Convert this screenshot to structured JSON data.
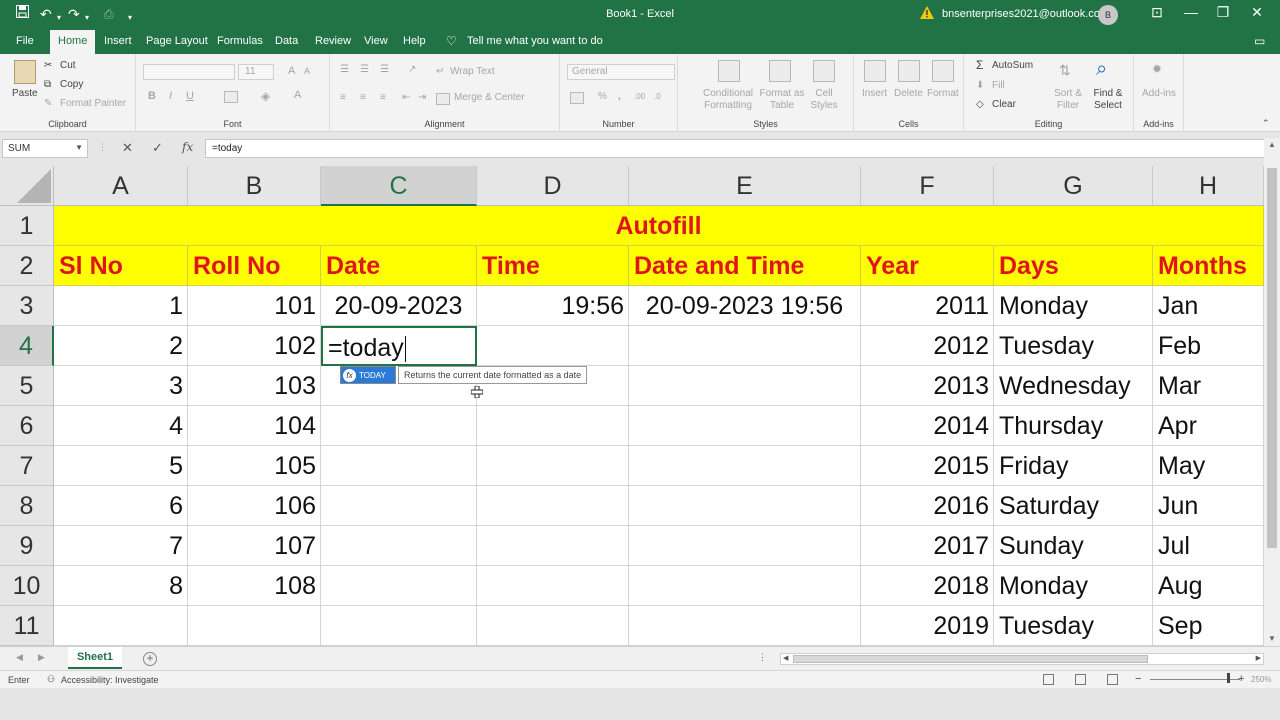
{
  "window": {
    "title": "Book1 - Excel",
    "account_email": "bnsenterprises2021@outlook.com",
    "avatar_initial": "B"
  },
  "menu": {
    "tabs": [
      "File",
      "Home",
      "Insert",
      "Page Layout",
      "Formulas",
      "Data",
      "Review",
      "View",
      "Help"
    ],
    "active_tab": "Home",
    "tell_me": "Tell me what you want to do"
  },
  "ribbon": {
    "clipboard": {
      "label": "Clipboard",
      "paste": "Paste",
      "cut": "Cut",
      "copy": "Copy",
      "format_painter": "Format Painter"
    },
    "font": {
      "label": "Font",
      "size": "11"
    },
    "alignment": {
      "label": "Alignment",
      "wrap_text": "Wrap Text",
      "merge_center": "Merge & Center"
    },
    "number": {
      "label": "Number",
      "format": "General"
    },
    "styles": {
      "label": "Styles",
      "conditional": "Conditional Formatting",
      "format_table": "Format as Table",
      "cell_styles": "Cell Styles"
    },
    "cells": {
      "label": "Cells",
      "insert": "Insert",
      "delete": "Delete",
      "format": "Format"
    },
    "editing": {
      "label": "Editing",
      "autosum": "AutoSum",
      "fill": "Fill",
      "clear": "Clear",
      "sort_filter": "Sort & Filter",
      "find_select": "Find & Select"
    },
    "addins": {
      "label": "Add-ins",
      "addins": "Add-ins"
    }
  },
  "formula_bar": {
    "name_box": "SUM",
    "formula": "=today"
  },
  "grid": {
    "columns": [
      "A",
      "B",
      "C",
      "D",
      "E",
      "F",
      "G",
      "H"
    ],
    "selected_column": "C",
    "rows": [
      "1",
      "2",
      "3",
      "4",
      "5",
      "6",
      "7",
      "8",
      "9",
      "10",
      "11"
    ],
    "selected_row": "4",
    "title": "Autofill",
    "headers": [
      "Sl No",
      "Roll No",
      "Date",
      "Time",
      "Date and Time",
      "Year",
      "Days",
      "Months"
    ],
    "data": [
      [
        "1",
        "101",
        "20-09-2023",
        "19:56",
        "20-09-2023 19:56",
        "2011",
        "Monday",
        "Jan"
      ],
      [
        "2",
        "102",
        "=today",
        "",
        "",
        "2012",
        "Tuesday",
        "Feb"
      ],
      [
        "3",
        "103",
        "",
        "",
        "",
        "2013",
        "Wednesday",
        "Mar"
      ],
      [
        "4",
        "104",
        "",
        "",
        "",
        "2014",
        "Thursday",
        "Apr"
      ],
      [
        "5",
        "105",
        "",
        "",
        "",
        "2015",
        "Friday",
        "May"
      ],
      [
        "6",
        "106",
        "",
        "",
        "",
        "2016",
        "Saturday",
        "Jun"
      ],
      [
        "7",
        "107",
        "",
        "",
        "",
        "2017",
        "Sunday",
        "Jul"
      ],
      [
        "8",
        "108",
        "",
        "",
        "",
        "2018",
        "Monday",
        "Aug"
      ],
      [
        "",
        "",
        "",
        "",
        "",
        "2019",
        "Tuesday",
        "Sep"
      ]
    ]
  },
  "autocomplete": {
    "function_name": "TODAY",
    "description": "Returns the current date formatted as a date"
  },
  "sheets": {
    "tabs": [
      "Sheet1"
    ],
    "active": "Sheet1"
  },
  "status": {
    "mode": "Enter",
    "accessibility": "Accessibility: Investigate",
    "zoom": "250%"
  },
  "colors": {
    "excel_green": "#217346",
    "header_fill": "#ffff00",
    "header_text": "#e0141e"
  }
}
